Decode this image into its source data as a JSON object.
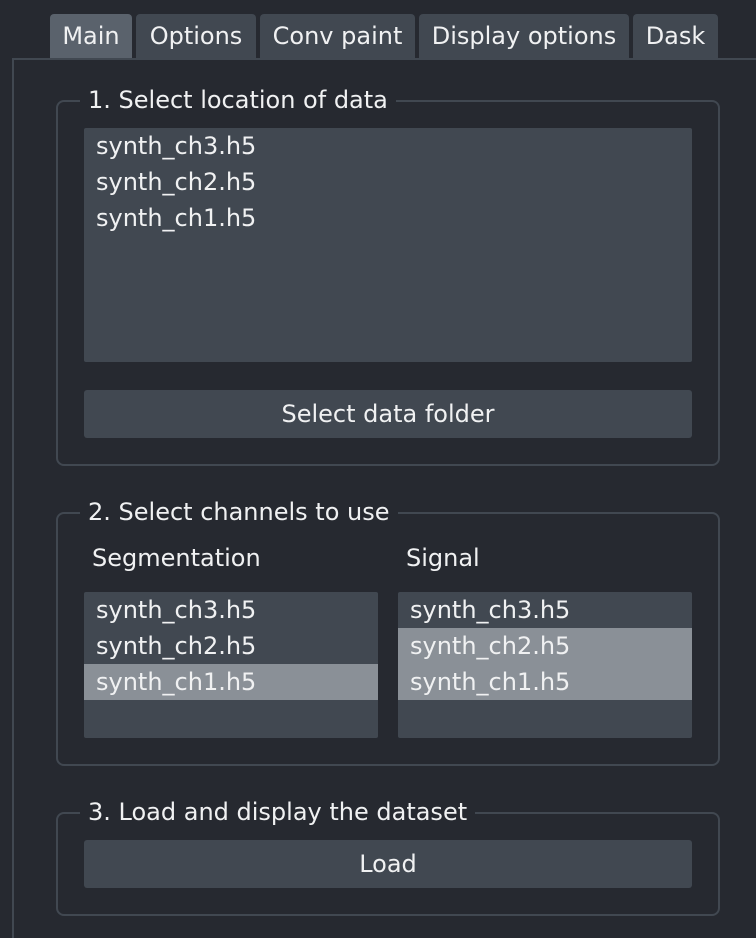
{
  "tabs": [
    {
      "label": "Main",
      "active": true
    },
    {
      "label": "Options",
      "active": false
    },
    {
      "label": "Conv paint",
      "active": false
    },
    {
      "label": "Display options",
      "active": false
    },
    {
      "label": "Dask",
      "active": false
    }
  ],
  "section1": {
    "title": "1. Select location of data",
    "files": [
      "synth_ch3.h5",
      "synth_ch2.h5",
      "synth_ch1.h5"
    ],
    "select_button": "Select data folder"
  },
  "section2": {
    "title": "2. Select channels to use",
    "segmentation_label": "Segmentation",
    "signal_label": "Signal",
    "segmentation_items": [
      {
        "label": "synth_ch3.h5",
        "selected": false
      },
      {
        "label": "synth_ch2.h5",
        "selected": false
      },
      {
        "label": "synth_ch1.h5",
        "selected": true
      }
    ],
    "signal_items": [
      {
        "label": "synth_ch3.h5",
        "selected": false
      },
      {
        "label": "synth_ch2.h5",
        "selected": true
      },
      {
        "label": "synth_ch1.h5",
        "selected": true
      }
    ]
  },
  "section3": {
    "title": "3. Load and display the dataset",
    "load_button": "Load"
  },
  "colors": {
    "background": "#262930",
    "widget": "#414851",
    "selected": "#8a9097",
    "active_tab": "#5a626c",
    "text": "#f0f1f2"
  }
}
